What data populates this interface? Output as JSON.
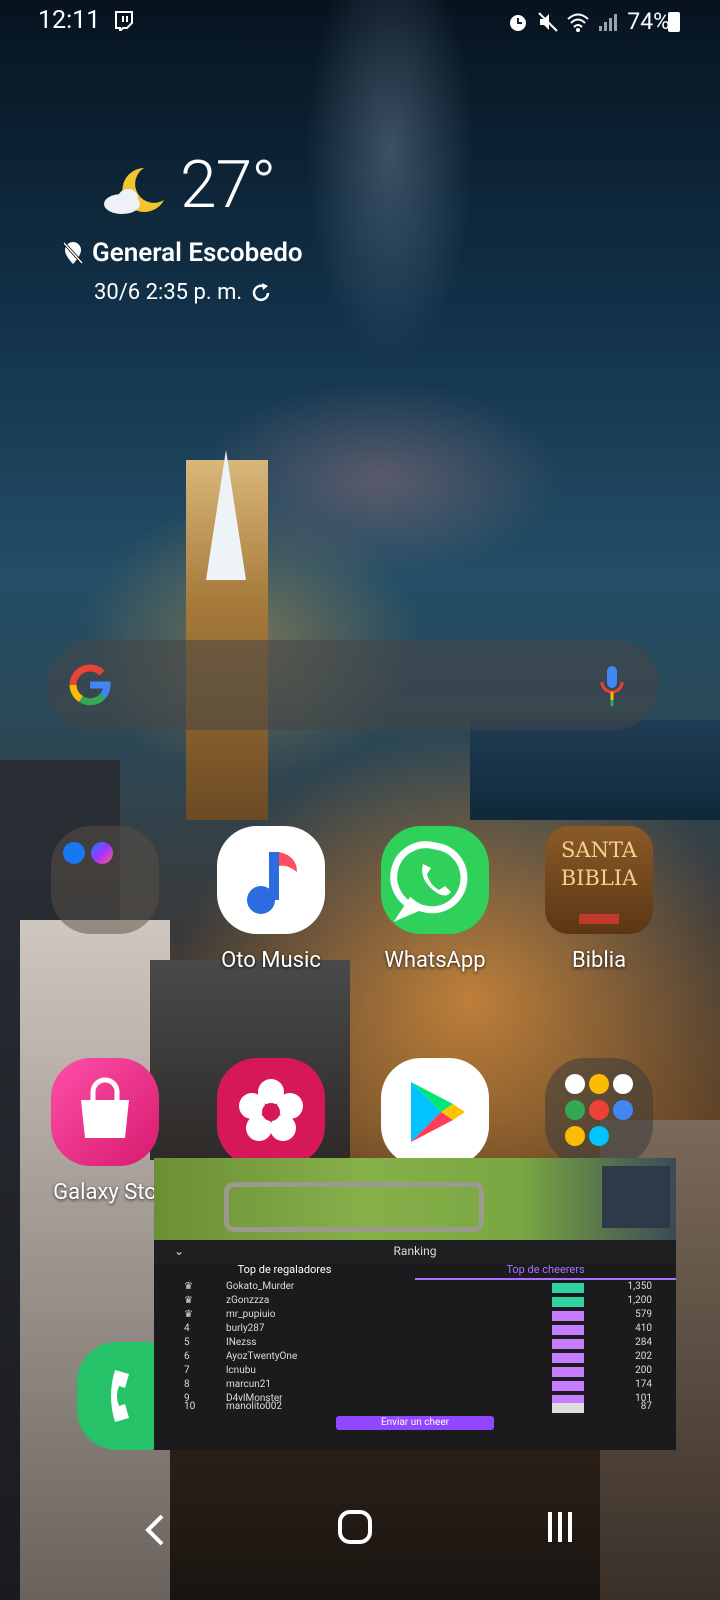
{
  "status_bar": {
    "time": "12:11",
    "battery": "74%",
    "icons": [
      "twitch-icon",
      "alarm-icon",
      "mute-icon",
      "wifi-icon",
      "signal-icon",
      "battery-icon"
    ]
  },
  "weather": {
    "temperature": "27°",
    "location": "General Escobedo",
    "updated": "30/6 2:35 p. m."
  },
  "search": {
    "icons": [
      "google-logo",
      "mic-icon"
    ]
  },
  "apps": {
    "row1": [
      {
        "label": "",
        "icon": "facebook-messenger-folder"
      },
      {
        "label": "Oto Music",
        "icon": "music-note-icon"
      },
      {
        "label": "WhatsApp",
        "icon": "whatsapp-icon"
      },
      {
        "label": "Biblia",
        "icon": "bible-icon",
        "tile_text_1": "SANTA",
        "tile_text_2": "BIBLIA"
      }
    ],
    "row2": [
      {
        "label": "Galaxy Sto",
        "icon": "shopping-bag-icon"
      },
      {
        "label": "",
        "icon": "flower-icon"
      },
      {
        "label": "",
        "icon": "play-store-icon"
      },
      {
        "label": "",
        "icon": "google-apps-folder"
      }
    ],
    "dock": [
      {
        "label": "",
        "icon": "phone-icon"
      }
    ]
  },
  "overlay": {
    "header": "Ranking",
    "tabs": [
      "Top de regaladores",
      "Top de cheerers"
    ],
    "rows": [
      {
        "rank": "",
        "name": "Gokato_Murder",
        "value": "1,350"
      },
      {
        "rank": "",
        "name": "zGonzzza",
        "value": "1,200"
      },
      {
        "rank": "",
        "name": "mr_pupiuio",
        "value": "579"
      },
      {
        "rank": "4",
        "name": "burly287",
        "value": "410"
      },
      {
        "rank": "5",
        "name": "INezss",
        "value": "284"
      },
      {
        "rank": "6",
        "name": "AyozTwentyOne",
        "value": "202"
      },
      {
        "rank": "7",
        "name": "lcnubu",
        "value": "200"
      },
      {
        "rank": "8",
        "name": "marcun21",
        "value": "174"
      },
      {
        "rank": "9",
        "name": "D4vlMonster",
        "value": "101"
      },
      {
        "rank": "10",
        "name": "manolito002",
        "value": "87"
      }
    ],
    "button": "Enviar un cheer"
  },
  "nav": {
    "icons": [
      "back-icon",
      "home-icon",
      "recents-icon"
    ]
  }
}
